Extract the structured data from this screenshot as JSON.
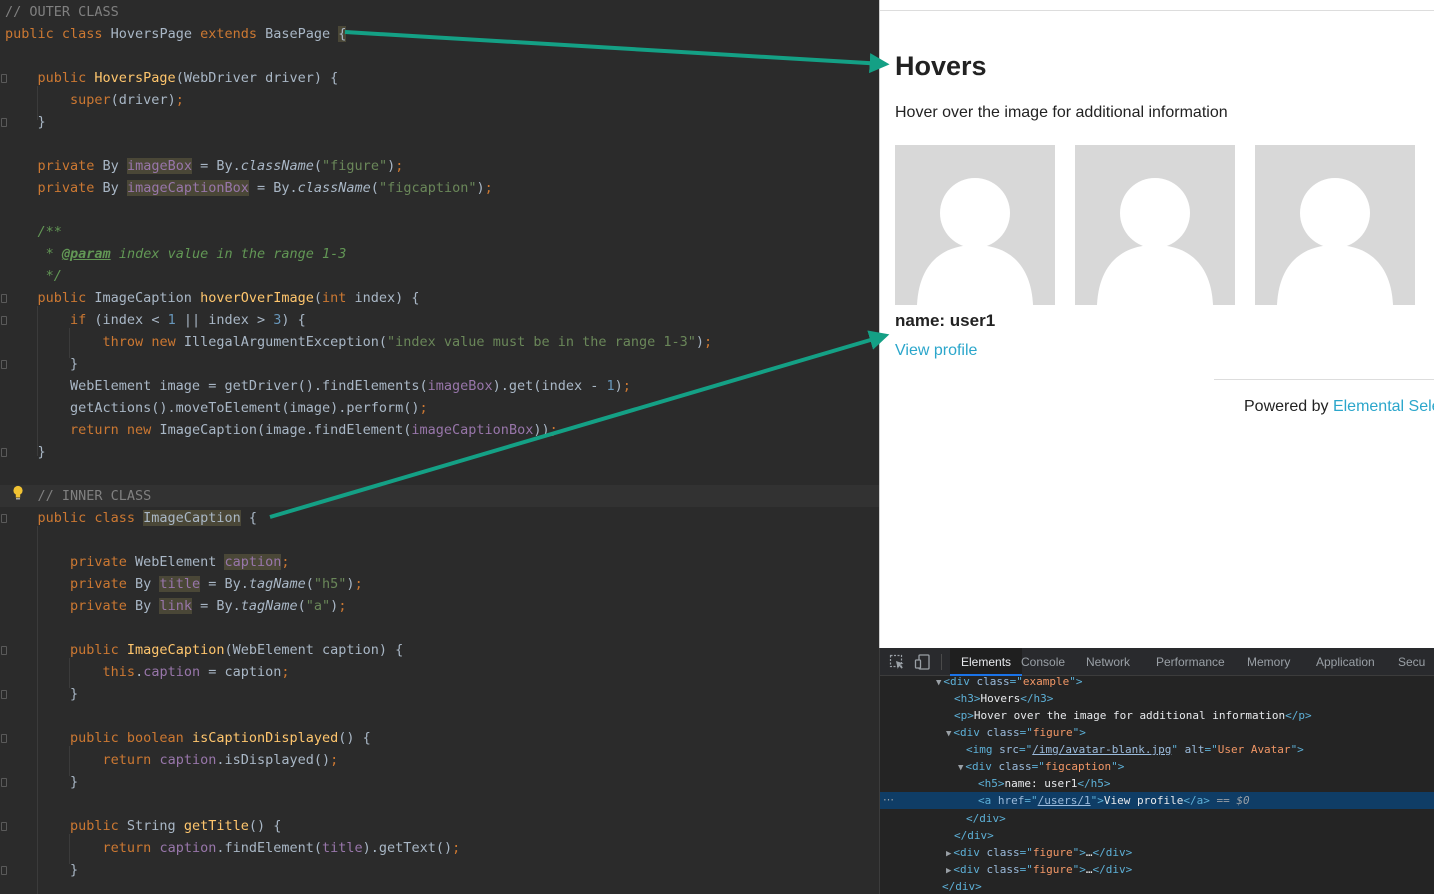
{
  "editor": {
    "lines": [
      [
        {
          "t": "// OUTER CLASS",
          "c": "c"
        }
      ],
      [
        {
          "t": "public class ",
          "c": "k"
        },
        {
          "t": "HoversPage "
        },
        {
          "t": "extends ",
          "c": "k"
        },
        {
          "t": "BasePage "
        },
        {
          "t": "{",
          "c": "hl"
        }
      ],
      [],
      [
        {
          "t": "    public ",
          "c": "k"
        },
        {
          "t": "HoversPage",
          "c": "f"
        },
        {
          "t": "(WebDriver driver) {"
        }
      ],
      [
        {
          "t": "        "
        },
        {
          "t": "super",
          "c": "k"
        },
        {
          "t": "(driver)"
        },
        {
          "t": ";",
          "c": "k"
        }
      ],
      [
        {
          "t": "    }"
        }
      ],
      [],
      [
        {
          "t": "    private ",
          "c": "k"
        },
        {
          "t": "By "
        },
        {
          "t": "imageBox",
          "c": "hlv"
        },
        {
          "t": " = By."
        },
        {
          "t": "className",
          "c": "st"
        },
        {
          "t": "("
        },
        {
          "t": "\"figure\"",
          "c": "s"
        },
        {
          "t": ")"
        },
        {
          "t": ";",
          "c": "k"
        }
      ],
      [
        {
          "t": "    private ",
          "c": "k"
        },
        {
          "t": "By "
        },
        {
          "t": "imageCaptionBox",
          "c": "hlv"
        },
        {
          "t": " = By."
        },
        {
          "t": "className",
          "c": "st"
        },
        {
          "t": "("
        },
        {
          "t": "\"figcaption\"",
          "c": "s"
        },
        {
          "t": ")"
        },
        {
          "t": ";",
          "c": "k"
        }
      ],
      [],
      [
        {
          "t": "    /**",
          "c": "dc"
        }
      ],
      [
        {
          "t": "     * ",
          "c": "dc"
        },
        {
          "t": "@param",
          "c": "dt"
        },
        {
          "t": " index value in the range 1-3",
          "c": "dc"
        }
      ],
      [
        {
          "t": "     */",
          "c": "dc"
        }
      ],
      [
        {
          "t": "    public ",
          "c": "k"
        },
        {
          "t": "ImageCaption "
        },
        {
          "t": "hoverOverImage",
          "c": "f"
        },
        {
          "t": "("
        },
        {
          "t": "int ",
          "c": "k"
        },
        {
          "t": "index) {"
        }
      ],
      [
        {
          "t": "        "
        },
        {
          "t": "if ",
          "c": "k"
        },
        {
          "t": "(index < "
        },
        {
          "t": "1 ",
          "c": "n"
        },
        {
          "t": "|| index > "
        },
        {
          "t": "3",
          "c": "n"
        },
        {
          "t": ") {"
        }
      ],
      [
        {
          "t": "            "
        },
        {
          "t": "throw new ",
          "c": "k"
        },
        {
          "t": "IllegalArgumentException("
        },
        {
          "t": "\"index value must be in the range 1-3\"",
          "c": "s"
        },
        {
          "t": ")"
        },
        {
          "t": ";",
          "c": "k"
        }
      ],
      [
        {
          "t": "        }"
        }
      ],
      [
        {
          "t": "        WebElement image = getDriver().findElements("
        },
        {
          "t": "imageBox",
          "c": "fd"
        },
        {
          "t": ").get(index - "
        },
        {
          "t": "1",
          "c": "n"
        },
        {
          "t": ")"
        },
        {
          "t": ";",
          "c": "k"
        }
      ],
      [
        {
          "t": "        getActions().moveToElement(image).perform()"
        },
        {
          "t": ";",
          "c": "k"
        }
      ],
      [
        {
          "t": "        "
        },
        {
          "t": "return new ",
          "c": "k"
        },
        {
          "t": "ImageCaption(image.findElement("
        },
        {
          "t": "imageCaptionBox",
          "c": "fd"
        },
        {
          "t": "))"
        },
        {
          "t": ";",
          "c": "k"
        }
      ],
      [
        {
          "t": "    }"
        }
      ],
      [],
      [
        {
          "t": "    // INNER CLASS",
          "c": "c"
        }
      ],
      [
        {
          "t": "    public class ",
          "c": "k"
        },
        {
          "t": "ImageCaption",
          "c": "hl"
        },
        {
          "t": " {"
        }
      ],
      [],
      [
        {
          "t": "        private ",
          "c": "k"
        },
        {
          "t": "WebElement "
        },
        {
          "t": "caption",
          "c": "hlv"
        },
        {
          "t": ";",
          "c": "k"
        }
      ],
      [
        {
          "t": "        private ",
          "c": "k"
        },
        {
          "t": "By "
        },
        {
          "t": "title",
          "c": "hlv"
        },
        {
          "t": " = By."
        },
        {
          "t": "tagName",
          "c": "st"
        },
        {
          "t": "("
        },
        {
          "t": "\"h5\"",
          "c": "s"
        },
        {
          "t": ")"
        },
        {
          "t": ";",
          "c": "k"
        }
      ],
      [
        {
          "t": "        private ",
          "c": "k"
        },
        {
          "t": "By "
        },
        {
          "t": "link",
          "c": "hlv"
        },
        {
          "t": " = By."
        },
        {
          "t": "tagName",
          "c": "st"
        },
        {
          "t": "("
        },
        {
          "t": "\"a\"",
          "c": "s"
        },
        {
          "t": ")"
        },
        {
          "t": ";",
          "c": "k"
        }
      ],
      [],
      [
        {
          "t": "        public ",
          "c": "k"
        },
        {
          "t": "ImageCaption",
          "c": "f"
        },
        {
          "t": "(WebElement caption) {"
        }
      ],
      [
        {
          "t": "            "
        },
        {
          "t": "this",
          "c": "k"
        },
        {
          "t": "."
        },
        {
          "t": "caption",
          "c": "fd"
        },
        {
          "t": " = caption"
        },
        {
          "t": ";",
          "c": "k"
        }
      ],
      [
        {
          "t": "        }"
        }
      ],
      [],
      [
        {
          "t": "        public boolean ",
          "c": "k"
        },
        {
          "t": "isCaptionDisplayed",
          "c": "f"
        },
        {
          "t": "() {"
        }
      ],
      [
        {
          "t": "            "
        },
        {
          "t": "return ",
          "c": "k"
        },
        {
          "t": "caption",
          "c": "fd"
        },
        {
          "t": ".isDisplayed()"
        },
        {
          "t": ";",
          "c": "k"
        }
      ],
      [
        {
          "t": "        }"
        }
      ],
      [],
      [
        {
          "t": "        public ",
          "c": "k"
        },
        {
          "t": "String "
        },
        {
          "t": "getTitle",
          "c": "f"
        },
        {
          "t": "() {"
        }
      ],
      [
        {
          "t": "            "
        },
        {
          "t": "return ",
          "c": "k"
        },
        {
          "t": "caption",
          "c": "fd"
        },
        {
          "t": ".findElement("
        },
        {
          "t": "title",
          "c": "fd"
        },
        {
          "t": ").getText()"
        },
        {
          "t": ";",
          "c": "k"
        }
      ],
      [
        {
          "t": "        }"
        }
      ]
    ]
  },
  "page": {
    "heading": "Hovers",
    "description": "Hover over the image for additional information",
    "caption_title": "name: user1",
    "caption_link": "View profile",
    "footer_prefix": "Powered by ",
    "footer_link": "Elemental Sele",
    "figure_alt": "User Avatar"
  },
  "devtools": {
    "tabs": [
      "Elements",
      "Console",
      "Network",
      "Performance",
      "Memory",
      "Application",
      "Secu"
    ],
    "active_tab": "Elements",
    "dom_lines": [
      [
        {
          "t": "▼",
          "c": "tri"
        },
        {
          "t": "<div ",
          "c": "tg"
        },
        {
          "t": "class",
          "c": "an"
        },
        {
          "t": "=\"",
          "c": "tg"
        },
        {
          "t": "example",
          "c": "av"
        },
        {
          "t": "\">",
          "c": "tg"
        }
      ],
      [
        {
          "t": "<h3>",
          "c": "tg"
        },
        {
          "t": "Hovers",
          "c": "tx"
        },
        {
          "t": "</h3>",
          "c": "tg"
        }
      ],
      [
        {
          "t": "<p>",
          "c": "tg"
        },
        {
          "t": "Hover over the image for additional information",
          "c": "tx"
        },
        {
          "t": "</p>",
          "c": "tg"
        }
      ],
      [
        {
          "t": "▼",
          "c": "tri"
        },
        {
          "t": "<div ",
          "c": "tg"
        },
        {
          "t": "class",
          "c": "an"
        },
        {
          "t": "=\"",
          "c": "tg"
        },
        {
          "t": "figure",
          "c": "av"
        },
        {
          "t": "\">",
          "c": "tg"
        }
      ],
      [
        {
          "t": "<img ",
          "c": "tg"
        },
        {
          "t": "src",
          "c": "an"
        },
        {
          "t": "=\"",
          "c": "tg"
        },
        {
          "t": "/img/avatar-blank.jpg",
          "c": "ul"
        },
        {
          "t": "\" ",
          "c": "tg"
        },
        {
          "t": "alt",
          "c": "an"
        },
        {
          "t": "=\"",
          "c": "tg"
        },
        {
          "t": "User Avatar",
          "c": "av"
        },
        {
          "t": "\">",
          "c": "tg"
        }
      ],
      [
        {
          "t": "▼",
          "c": "tri"
        },
        {
          "t": "<div ",
          "c": "tg"
        },
        {
          "t": "class",
          "c": "an"
        },
        {
          "t": "=\"",
          "c": "tg"
        },
        {
          "t": "figcaption",
          "c": "av"
        },
        {
          "t": "\">",
          "c": "tg"
        }
      ],
      [
        {
          "t": "<h5>",
          "c": "tg"
        },
        {
          "t": "name: user1",
          "c": "tx"
        },
        {
          "t": "</h5>",
          "c": "tg"
        }
      ],
      [
        {
          "t": "<a ",
          "c": "tg"
        },
        {
          "t": "href",
          "c": "an"
        },
        {
          "t": "=\"",
          "c": "tg"
        },
        {
          "t": "/users/1",
          "c": "ul"
        },
        {
          "t": "\">",
          "c": "tg"
        },
        {
          "t": "View profile",
          "c": "tx"
        },
        {
          "t": "</a>",
          "c": "tg"
        },
        {
          "t": " == ",
          "c": "eq"
        },
        {
          "t": "$0",
          "c": "sv"
        }
      ],
      [
        {
          "t": "</div>",
          "c": "tg"
        }
      ],
      [
        {
          "t": "</div>",
          "c": "tg"
        }
      ],
      [
        {
          "t": "▶",
          "c": "tri"
        },
        {
          "t": "<div ",
          "c": "tg"
        },
        {
          "t": "class",
          "c": "an"
        },
        {
          "t": "=\"",
          "c": "tg"
        },
        {
          "t": "figure",
          "c": "av"
        },
        {
          "t": "\">",
          "c": "tg"
        },
        {
          "t": "…",
          "c": "tx"
        },
        {
          "t": "</div>",
          "c": "tg"
        }
      ],
      [
        {
          "t": "▶",
          "c": "tri"
        },
        {
          "t": "<div ",
          "c": "tg"
        },
        {
          "t": "class",
          "c": "an"
        },
        {
          "t": "=\"",
          "c": "tg"
        },
        {
          "t": "figure",
          "c": "av"
        },
        {
          "t": "\">",
          "c": "tg"
        },
        {
          "t": "…",
          "c": "tx"
        },
        {
          "t": "</div>",
          "c": "tg"
        }
      ],
      [
        {
          "t": "</div>",
          "c": "tg"
        }
      ]
    ],
    "selected_line_gutter": "⋯"
  },
  "colors": {
    "editor_bg": "#2b2b2b",
    "keyword": "#cc7832",
    "string": "#6a8759",
    "arrow": "#14a085",
    "link": "#2ba6cb",
    "devtools_selection": "#0f3d66"
  },
  "icons": [
    "lightbulb-icon",
    "inspect-element-icon",
    "device-toolbar-icon",
    "avatar-icon",
    "arrow-icon"
  ]
}
